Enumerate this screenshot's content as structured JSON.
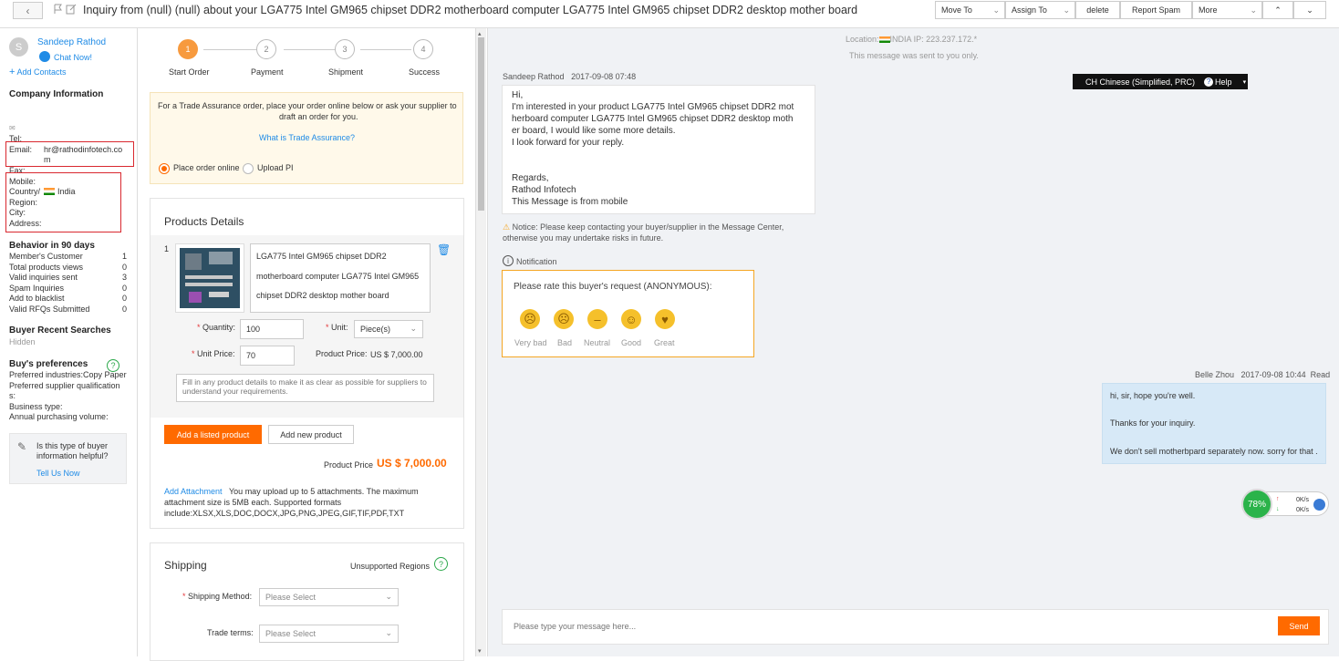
{
  "header": {
    "subject": "Inquiry from (null) (null) about your LGA775 Intel GM965 chipset DDR2 motherboard computer LGA775 Intel GM965 chipset DDR2 desktop mother board",
    "buttons": {
      "move_to": "Move To",
      "assign_to": "Assign To",
      "delete": "delete",
      "report_spam": "Report Spam",
      "more": "More"
    }
  },
  "contact": {
    "avatar_letter": "S",
    "name": "Sandeep Rathod",
    "chat": "Chat Now!",
    "add_contacts": "Add Contacts",
    "company_info_title": "Company Information",
    "tel": "Tel:",
    "email_label": "Email:",
    "email_l1": "hr@rathodinfotech.co",
    "email_l2": "m",
    "fax": "Fax:",
    "mobile": "Mobile:",
    "country_label": "Country/",
    "country": "India",
    "region": "Region:",
    "city": "City:",
    "address": "Address:"
  },
  "behavior": {
    "title": "Behavior in 90 days",
    "rows": [
      {
        "label": "Member's Customer",
        "value": "1"
      },
      {
        "label": "Total products views",
        "value": "0"
      },
      {
        "label": "Valid inquiries sent",
        "value": "3"
      },
      {
        "label": "Spam Inquiries",
        "value": "0"
      },
      {
        "label": "Add to blacklist",
        "value": "0"
      },
      {
        "label": "Valid RFQs Submitted",
        "value": "0"
      }
    ]
  },
  "searches": {
    "title": "Buyer Recent Searches",
    "value": "Hidden"
  },
  "prefs": {
    "title": "Buy's preferences",
    "industries": "Preferred industries:Copy Paper",
    "qual_l1": "Preferred supplier qualification",
    "qual_l2": "s:",
    "business": "Business type:",
    "volume": "Annual purchasing volume:"
  },
  "helpful": {
    "l1": "Is this type of buyer",
    "l2": "information helpful?",
    "link": "Tell Us Now"
  },
  "steps": [
    {
      "num": "1",
      "label": "Start Order"
    },
    {
      "num": "2",
      "label": "Payment"
    },
    {
      "num": "3",
      "label": "Shipment"
    },
    {
      "num": "4",
      "label": "Success"
    }
  ],
  "trade": {
    "l1": "For a Trade Assurance order, place your order online below or ask your supplier to",
    "l2": "draft an order for you.",
    "link": "What is Trade Assurance?",
    "opt_online": "Place order online",
    "opt_upload": "Upload PI"
  },
  "products": {
    "title": "Products Details",
    "index": "1",
    "name_l1": "LGA775 Intel GM965 chipset DDR2",
    "name_l2": "motherboard computer LGA775 Intel GM965",
    "name_l3": "chipset DDR2 desktop mother board",
    "qty_label": "Quantity:",
    "qty": "100",
    "unit_label": "Unit:",
    "unit": "Piece(s)",
    "price_label": "Unit Price:",
    "price": "70",
    "product_price_label": "Product Price:",
    "product_price": "US $ 7,000.00",
    "details_placeholder": "Fill in any product details to make it as clear as possible for suppliers to understand your requirements.",
    "add_listed": "Add a listed product",
    "add_new": "Add new product",
    "total_label": "Product Price",
    "total": "US $ 7,000.00",
    "attach_link": "Add Attachment",
    "attach_l1": "You may upload up to 5 attachments. The maximum",
    "attach_l2": "attachment size is 5MB each. Supported formats",
    "attach_l3": "include:XLSX,XLS,DOC,DOCX,JPG,PNG,JPEG,GIF,TIF,PDF,TXT"
  },
  "shipping": {
    "title": "Shipping",
    "unsupported": "Unsupported Regions",
    "method_label": "Shipping Method:",
    "method_placeholder": "Please Select",
    "terms_label": "Trade terms:",
    "terms_placeholder": "Please Select"
  },
  "chat": {
    "location_label": "Location:",
    "location_country": "INDIA",
    "ip": "IP: 223.237.172.*",
    "sent_notice": "This message was sent to you only.",
    "language": "CH Chinese (Simplified, PRC)",
    "help": "Help",
    "msg1_sender": "Sandeep Rathod",
    "msg1_time": "2017-09-08 07:48",
    "msg1_lines": [
      "Hi,",
      "I'm interested in your product LGA775 Intel GM965 chipset DDR2 mot",
      "herboard computer LGA775 Intel GM965 chipset DDR2 desktop moth",
      "er board, I would like some more details.",
      "I look forward for your reply.",
      "",
      "",
      "Regards,",
      "Rathod Infotech",
      "This Message is from mobile"
    ],
    "notice_l1": "Notice: Please keep contacting your buyer/supplier in the Message Center,",
    "notice_l2": "otherwise you may undertake risks in future.",
    "notification": "Notification",
    "rate_title": "Please rate this buyer's request (ANONYMOUS):",
    "ratings": [
      "Very bad",
      "Bad",
      "Neutral",
      "Good",
      "Great"
    ],
    "msg2_sender": "Belle Zhou",
    "msg2_time": "2017-09-08 10:44",
    "msg2_status": "Read",
    "msg2_l1": "hi, sir, hope you're well.",
    "msg2_l2": "Thanks for your inquiry.",
    "msg2_l3": "We don't sell motherbpard separately now. sorry for that .",
    "widget_pct": "78%",
    "widget_up": "0K/s",
    "widget_down": "0K/s",
    "input_placeholder": "Please type your message here...",
    "send": "Send"
  },
  "colors": {
    "accent": "#ff6a00",
    "link": "#1f8be6",
    "highlight_box": "#d9282f"
  }
}
